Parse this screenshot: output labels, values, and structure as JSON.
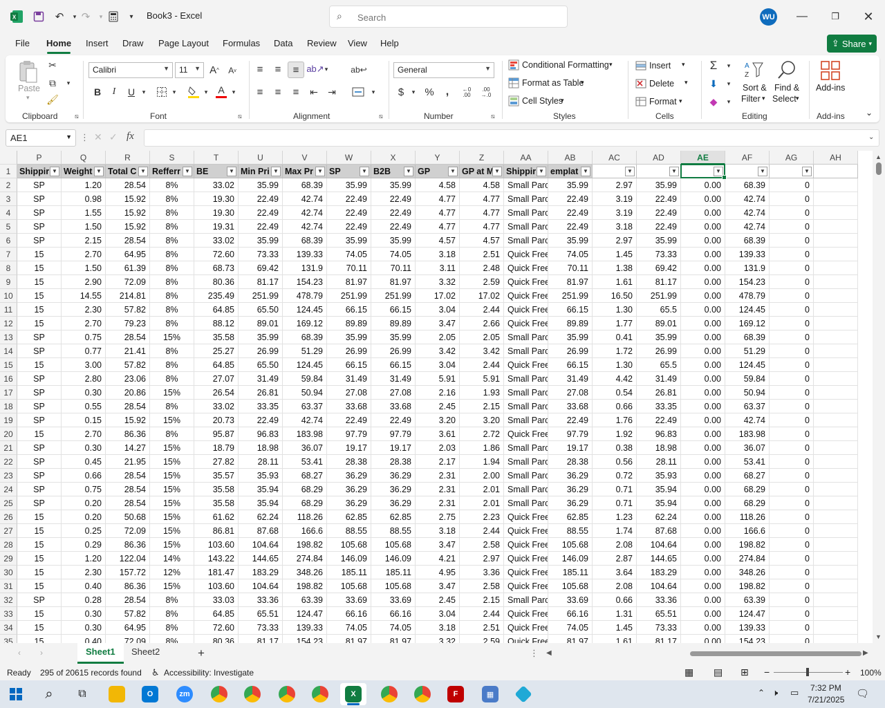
{
  "window": {
    "title": "Book3  -  Excel",
    "search_placeholder": "Search",
    "user_initials": "WU"
  },
  "menu": [
    "File",
    "Home",
    "Insert",
    "Draw",
    "Page Layout",
    "Formulas",
    "Data",
    "Review",
    "View",
    "Help"
  ],
  "share_label": "Share",
  "ribbon": {
    "clipboard": {
      "label": "Clipboard",
      "paste": "Paste"
    },
    "font": {
      "label": "Font",
      "name": "Calibri",
      "size": "11"
    },
    "alignment": {
      "label": "Alignment"
    },
    "number": {
      "label": "Number",
      "format": "General"
    },
    "styles": {
      "label": "Styles",
      "conditional": "Conditional Formatting",
      "format_table": "Format as Table",
      "cell_styles": "Cell Styles"
    },
    "cells": {
      "label": "Cells",
      "insert": "Insert",
      "delete": "Delete",
      "format": "Format"
    },
    "editing": {
      "label": "Editing",
      "sort1": "Sort &",
      "sort2": "Filter",
      "find1": "Find &",
      "find2": "Select"
    },
    "addins": {
      "label": "Add-ins",
      "button": "Add-ins"
    }
  },
  "formula_bar": {
    "name_box": "AE1",
    "fx": "fx",
    "formula": ""
  },
  "grid": {
    "col_letters": [
      "P",
      "Q",
      "R",
      "S",
      "T",
      "U",
      "V",
      "W",
      "X",
      "Y",
      "Z",
      "AA",
      "AB",
      "AC",
      "AD",
      "AE",
      "AF",
      "AG",
      "AH"
    ],
    "selected_col": "AE",
    "headers": [
      "Shippir",
      "Weight",
      "Total C",
      "Refferr",
      "BE",
      "Min Pri",
      "Max Pr",
      "SP",
      "B2B",
      "GP",
      "GP at M",
      "Shippir",
      "emplat",
      "",
      "",
      "",
      "",
      "",
      ""
    ],
    "row_numbers": [
      "1",
      "2",
      "3",
      "4",
      "5",
      "6",
      "7",
      "8",
      "9",
      "10",
      "11",
      "12",
      "13",
      "14",
      "15",
      "16",
      "17",
      "18",
      "19",
      "20",
      "21",
      "22",
      "23",
      "24",
      "25",
      "26",
      "27",
      "28",
      "29",
      "30",
      "31",
      "32",
      "33",
      "34",
      "35"
    ],
    "rows": [
      [
        "SP",
        "1.20",
        "28.54",
        "8%",
        "33.02",
        "35.99",
        "68.39",
        "35.99",
        "35.99",
        "4.58",
        "4.58",
        "Small Parc",
        "35.99",
        "2.97",
        "35.99",
        "0.00",
        "68.39",
        "0"
      ],
      [
        "SP",
        "0.98",
        "15.92",
        "8%",
        "19.30",
        "22.49",
        "42.74",
        "22.49",
        "22.49",
        "4.77",
        "4.77",
        "Small Parc",
        "22.49",
        "3.19",
        "22.49",
        "0.00",
        "42.74",
        "0"
      ],
      [
        "SP",
        "1.55",
        "15.92",
        "8%",
        "19.30",
        "22.49",
        "42.74",
        "22.49",
        "22.49",
        "4.77",
        "4.77",
        "Small Parc",
        "22.49",
        "3.19",
        "22.49",
        "0.00",
        "42.74",
        "0"
      ],
      [
        "SP",
        "1.50",
        "15.92",
        "8%",
        "19.31",
        "22.49",
        "42.74",
        "22.49",
        "22.49",
        "4.77",
        "4.77",
        "Small Parc",
        "22.49",
        "3.18",
        "22.49",
        "0.00",
        "42.74",
        "0"
      ],
      [
        "SP",
        "2.15",
        "28.54",
        "8%",
        "33.02",
        "35.99",
        "68.39",
        "35.99",
        "35.99",
        "4.57",
        "4.57",
        "Small Parc",
        "35.99",
        "2.97",
        "35.99",
        "0.00",
        "68.39",
        "0"
      ],
      [
        "15",
        "2.70",
        "64.95",
        "8%",
        "72.60",
        "73.33",
        "139.33",
        "74.05",
        "74.05",
        "3.18",
        "2.51",
        "Quick Free",
        "74.05",
        "1.45",
        "73.33",
        "0.00",
        "139.33",
        "0"
      ],
      [
        "15",
        "1.50",
        "61.39",
        "8%",
        "68.73",
        "69.42",
        "131.9",
        "70.11",
        "70.11",
        "3.11",
        "2.48",
        "Quick Free",
        "70.11",
        "1.38",
        "69.42",
        "0.00",
        "131.9",
        "0"
      ],
      [
        "15",
        "2.90",
        "72.09",
        "8%",
        "80.36",
        "81.17",
        "154.23",
        "81.97",
        "81.97",
        "3.32",
        "2.59",
        "Quick Free",
        "81.97",
        "1.61",
        "81.17",
        "0.00",
        "154.23",
        "0"
      ],
      [
        "15",
        "14.55",
        "214.81",
        "8%",
        "235.49",
        "251.99",
        "478.79",
        "251.99",
        "251.99",
        "17.02",
        "17.02",
        "Quick Free",
        "251.99",
        "16.50",
        "251.99",
        "0.00",
        "478.79",
        "0"
      ],
      [
        "15",
        "2.30",
        "57.82",
        "8%",
        "64.85",
        "65.50",
        "124.45",
        "66.15",
        "66.15",
        "3.04",
        "2.44",
        "Quick Free",
        "66.15",
        "1.30",
        "65.5",
        "0.00",
        "124.45",
        "0"
      ],
      [
        "15",
        "2.70",
        "79.23",
        "8%",
        "88.12",
        "89.01",
        "169.12",
        "89.89",
        "89.89",
        "3.47",
        "2.66",
        "Quick Free",
        "89.89",
        "1.77",
        "89.01",
        "0.00",
        "169.12",
        "0"
      ],
      [
        "SP",
        "0.75",
        "28.54",
        "15%",
        "35.58",
        "35.99",
        "68.39",
        "35.99",
        "35.99",
        "2.05",
        "2.05",
        "Small Parc",
        "35.99",
        "0.41",
        "35.99",
        "0.00",
        "68.39",
        "0"
      ],
      [
        "SP",
        "0.77",
        "21.41",
        "8%",
        "25.27",
        "26.99",
        "51.29",
        "26.99",
        "26.99",
        "3.42",
        "3.42",
        "Small Parc",
        "26.99",
        "1.72",
        "26.99",
        "0.00",
        "51.29",
        "0"
      ],
      [
        "15",
        "3.00",
        "57.82",
        "8%",
        "64.85",
        "65.50",
        "124.45",
        "66.15",
        "66.15",
        "3.04",
        "2.44",
        "Quick Free",
        "66.15",
        "1.30",
        "65.5",
        "0.00",
        "124.45",
        "0"
      ],
      [
        "SP",
        "2.80",
        "23.06",
        "8%",
        "27.07",
        "31.49",
        "59.84",
        "31.49",
        "31.49",
        "5.91",
        "5.91",
        "Small Parc",
        "31.49",
        "4.42",
        "31.49",
        "0.00",
        "59.84",
        "0"
      ],
      [
        "SP",
        "0.30",
        "20.86",
        "15%",
        "26.54",
        "26.81",
        "50.94",
        "27.08",
        "27.08",
        "2.16",
        "1.93",
        "Small Parc",
        "27.08",
        "0.54",
        "26.81",
        "0.00",
        "50.94",
        "0"
      ],
      [
        "SP",
        "0.55",
        "28.54",
        "8%",
        "33.02",
        "33.35",
        "63.37",
        "33.68",
        "33.68",
        "2.45",
        "2.15",
        "Small Parc",
        "33.68",
        "0.66",
        "33.35",
        "0.00",
        "63.37",
        "0"
      ],
      [
        "SP",
        "0.15",
        "15.92",
        "15%",
        "20.73",
        "22.49",
        "42.74",
        "22.49",
        "22.49",
        "3.20",
        "3.20",
        "Small Parc",
        "22.49",
        "1.76",
        "22.49",
        "0.00",
        "42.74",
        "0"
      ],
      [
        "15",
        "2.70",
        "86.36",
        "8%",
        "95.87",
        "96.83",
        "183.98",
        "97.79",
        "97.79",
        "3.61",
        "2.72",
        "Quick Free",
        "97.79",
        "1.92",
        "96.83",
        "0.00",
        "183.98",
        "0"
      ],
      [
        "SP",
        "0.30",
        "14.27",
        "15%",
        "18.79",
        "18.98",
        "36.07",
        "19.17",
        "19.17",
        "2.03",
        "1.86",
        "Small Parc",
        "19.17",
        "0.38",
        "18.98",
        "0.00",
        "36.07",
        "0"
      ],
      [
        "SP",
        "0.45",
        "21.95",
        "15%",
        "27.82",
        "28.11",
        "53.41",
        "28.38",
        "28.38",
        "2.17",
        "1.94",
        "Small Parc",
        "28.38",
        "0.56",
        "28.11",
        "0.00",
        "53.41",
        "0"
      ],
      [
        "SP",
        "0.66",
        "28.54",
        "15%",
        "35.57",
        "35.93",
        "68.27",
        "36.29",
        "36.29",
        "2.31",
        "2.00",
        "Small Parc",
        "36.29",
        "0.72",
        "35.93",
        "0.00",
        "68.27",
        "0"
      ],
      [
        "SP",
        "0.75",
        "28.54",
        "15%",
        "35.58",
        "35.94",
        "68.29",
        "36.29",
        "36.29",
        "2.31",
        "2.01",
        "Small Parc",
        "36.29",
        "0.71",
        "35.94",
        "0.00",
        "68.29",
        "0"
      ],
      [
        "SP",
        "0.20",
        "28.54",
        "15%",
        "35.58",
        "35.94",
        "68.29",
        "36.29",
        "36.29",
        "2.31",
        "2.01",
        "Small Parc",
        "36.29",
        "0.71",
        "35.94",
        "0.00",
        "68.29",
        "0"
      ],
      [
        "15",
        "0.20",
        "50.68",
        "15%",
        "61.62",
        "62.24",
        "118.26",
        "62.85",
        "62.85",
        "2.75",
        "2.23",
        "Quick Free",
        "62.85",
        "1.23",
        "62.24",
        "0.00",
        "118.26",
        "0"
      ],
      [
        "15",
        "0.25",
        "72.09",
        "15%",
        "86.81",
        "87.68",
        "166.6",
        "88.55",
        "88.55",
        "3.18",
        "2.44",
        "Quick Free",
        "88.55",
        "1.74",
        "87.68",
        "0.00",
        "166.6",
        "0"
      ],
      [
        "15",
        "0.29",
        "86.36",
        "15%",
        "103.60",
        "104.64",
        "198.82",
        "105.68",
        "105.68",
        "3.47",
        "2.58",
        "Quick Free",
        "105.68",
        "2.08",
        "104.64",
        "0.00",
        "198.82",
        "0"
      ],
      [
        "15",
        "1.20",
        "122.04",
        "14%",
        "143.22",
        "144.65",
        "274.84",
        "146.09",
        "146.09",
        "4.21",
        "2.97",
        "Quick Free",
        "146.09",
        "2.87",
        "144.65",
        "0.00",
        "274.84",
        "0"
      ],
      [
        "15",
        "2.30",
        "157.72",
        "12%",
        "181.47",
        "183.29",
        "348.26",
        "185.11",
        "185.11",
        "4.95",
        "3.36",
        "Quick Free",
        "185.11",
        "3.64",
        "183.29",
        "0.00",
        "348.26",
        "0"
      ],
      [
        "15",
        "0.40",
        "86.36",
        "15%",
        "103.60",
        "104.64",
        "198.82",
        "105.68",
        "105.68",
        "3.47",
        "2.58",
        "Quick Free",
        "105.68",
        "2.08",
        "104.64",
        "0.00",
        "198.82",
        "0"
      ],
      [
        "SP",
        "0.28",
        "28.54",
        "8%",
        "33.03",
        "33.36",
        "63.39",
        "33.69",
        "33.69",
        "2.45",
        "2.15",
        "Small Parc",
        "33.69",
        "0.66",
        "33.36",
        "0.00",
        "63.39",
        "0"
      ],
      [
        "15",
        "0.30",
        "57.82",
        "8%",
        "64.85",
        "65.51",
        "124.47",
        "66.16",
        "66.16",
        "3.04",
        "2.44",
        "Quick Free",
        "66.16",
        "1.31",
        "65.51",
        "0.00",
        "124.47",
        "0"
      ],
      [
        "15",
        "0.30",
        "64.95",
        "8%",
        "72.60",
        "73.33",
        "139.33",
        "74.05",
        "74.05",
        "3.18",
        "2.51",
        "Quick Free",
        "74.05",
        "1.45",
        "73.33",
        "0.00",
        "139.33",
        "0"
      ],
      [
        "15",
        "0.40",
        "72.09",
        "8%",
        "80.36",
        "81.17",
        "154.23",
        "81.97",
        "81.97",
        "3.32",
        "2.59",
        "Quick Free",
        "81.97",
        "1.61",
        "81.17",
        "0.00",
        "154.23",
        "0"
      ]
    ]
  },
  "sheets": [
    "Sheet1",
    "Sheet2"
  ],
  "active_sheet": "Sheet1",
  "status": {
    "ready": "Ready",
    "records": "295 of 20615 records found",
    "accessibility": "Accessibility: Investigate",
    "zoom": "100%"
  },
  "taskbar": {
    "time": "7:32 PM",
    "date": "7/21/2025"
  },
  "colors": {
    "excel_green": "#107c41",
    "accent_blue": "#0f6cbd"
  }
}
